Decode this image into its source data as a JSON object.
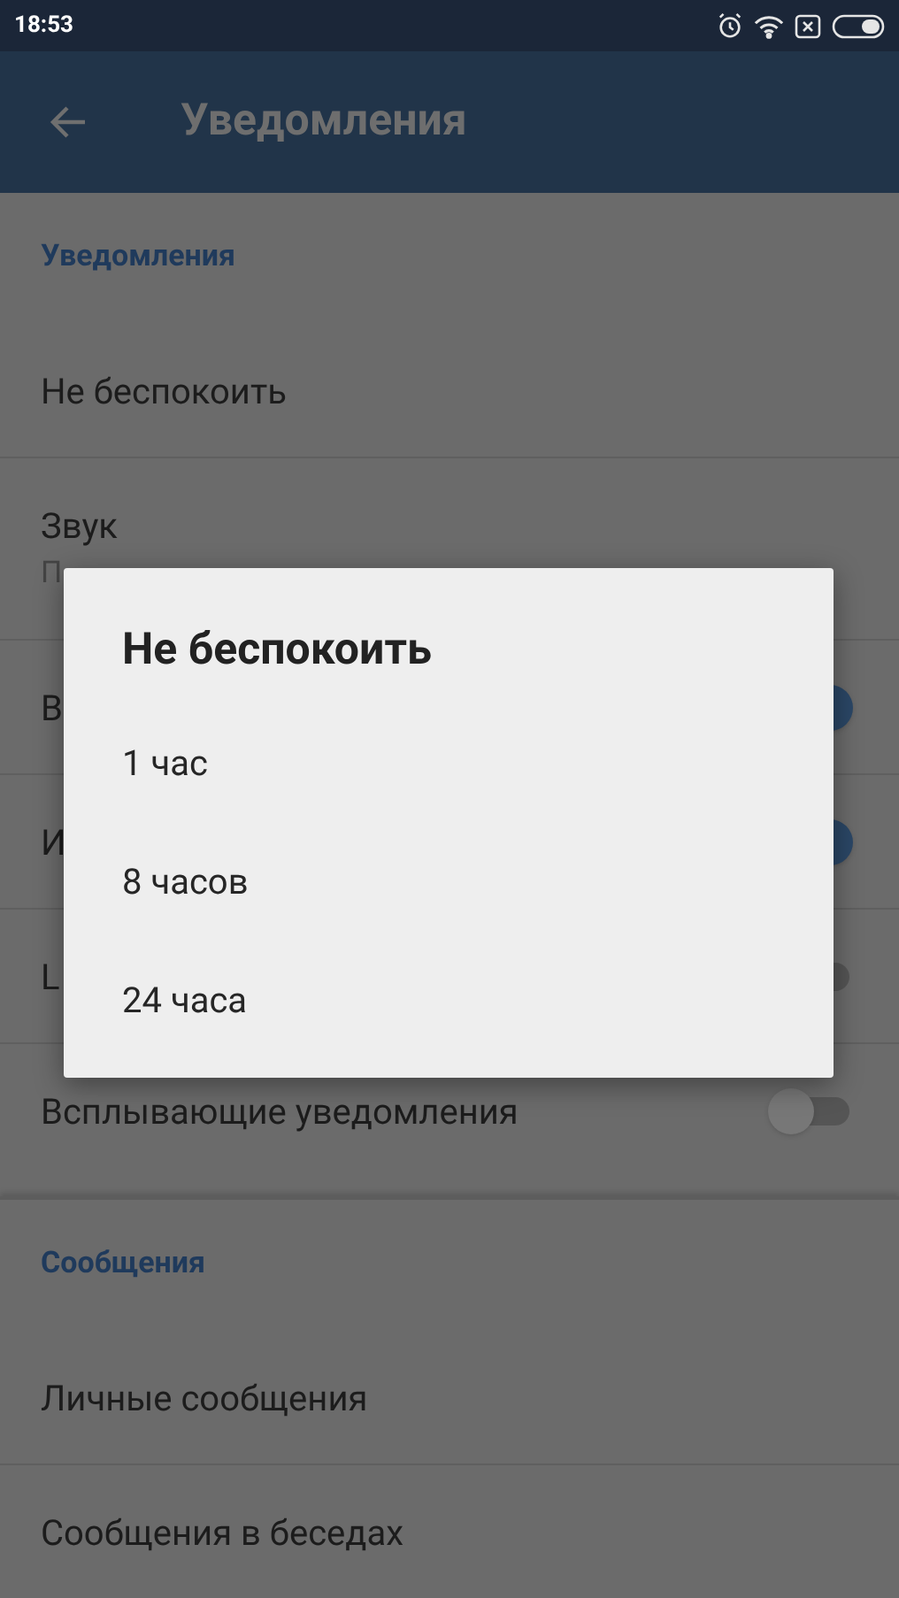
{
  "status_bar": {
    "time": "18:53"
  },
  "app_bar": {
    "title": "Уведомления"
  },
  "sections": [
    {
      "header": "Уведомления",
      "items": [
        {
          "kind": "plain",
          "label": "Не беспокоить"
        },
        {
          "kind": "subtitle",
          "label": "Звук",
          "subtitle": "П"
        },
        {
          "kind": "toggle",
          "label": "В",
          "on": true
        },
        {
          "kind": "toggle",
          "label": "И",
          "on": true
        },
        {
          "kind": "toggle",
          "label": "L",
          "on": false
        },
        {
          "kind": "toggle",
          "label": "Всплывающие уведомления",
          "on": false
        }
      ]
    },
    {
      "header": "Сообщения",
      "items": [
        {
          "kind": "plain",
          "label": "Личные сообщения"
        },
        {
          "kind": "plain",
          "label": "Сообщения в беседах"
        }
      ]
    }
  ],
  "dialog": {
    "title": "Не беспокоить",
    "options": [
      "1 час",
      "8 часов",
      "24 часа"
    ]
  }
}
